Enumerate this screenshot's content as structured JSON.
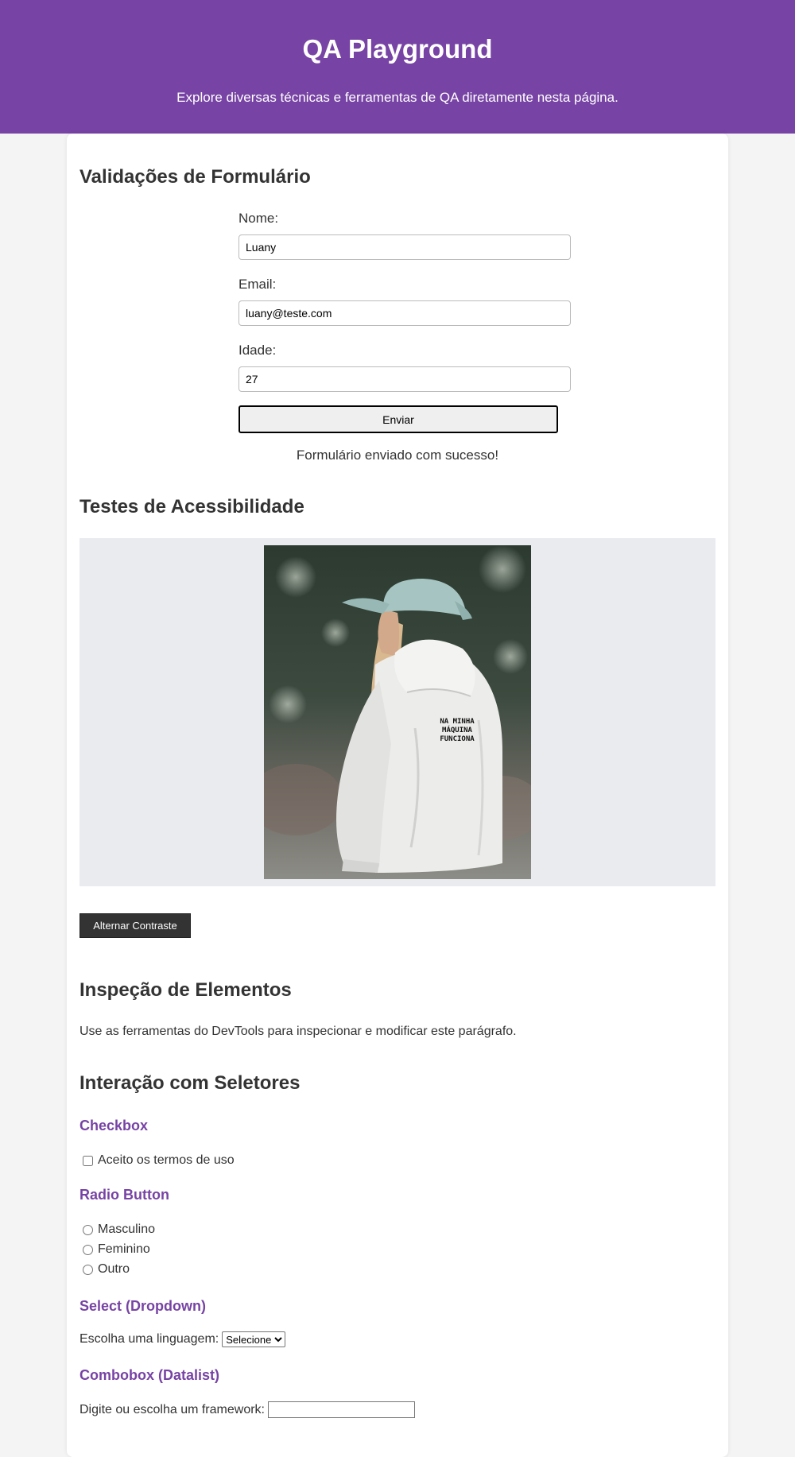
{
  "header": {
    "title": "QA Playground",
    "subtitle": "Explore diversas técnicas e ferramentas de QA diretamente nesta página."
  },
  "form_section": {
    "title": "Validações de Formulário",
    "name_label": "Nome:",
    "name_value": "Luany",
    "email_label": "Email:",
    "email_value": "luany@teste.com",
    "age_label": "Idade:",
    "age_value": "27",
    "submit_label": "Enviar",
    "success_message": "Formulário enviado com sucesso!"
  },
  "accessibility": {
    "title": "Testes de Acessibilidade",
    "shirt_text": [
      "NA MINHA",
      "MÁQUINA",
      "FUNCIONA"
    ],
    "toggle_button": "Alternar Contraste"
  },
  "inspection": {
    "title": "Inspeção de Elementos",
    "paragraph": "Use as ferramentas do DevTools para inspecionar e modificar este parágrafo."
  },
  "selectors": {
    "title": "Interação com Seletores",
    "checkbox_title": "Checkbox",
    "checkbox_label": "Aceito os termos de uso",
    "radio_title": "Radio Button",
    "radio_options": [
      "Masculino",
      "Feminino",
      "Outro"
    ],
    "select_title": "Select (Dropdown)",
    "select_label": "Escolha uma linguagem:",
    "select_value": "Selecione",
    "combobox_title": "Combobox (Datalist)",
    "combobox_label": "Digite ou escolha um framework:",
    "combobox_value": ""
  },
  "colors": {
    "header_bg": "#7743a4",
    "accent": "#7743a4",
    "page_bg": "#f4f4f4"
  }
}
